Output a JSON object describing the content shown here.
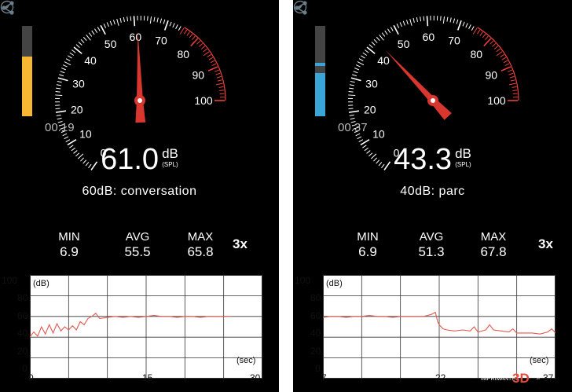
{
  "panels": [
    {
      "timer": "00:19",
      "reading_value": "61.0",
      "reading_unit": "dB",
      "reading_sub": "(SPL)",
      "description": "60dB: conversation",
      "stats": {
        "min_label": "MIN",
        "min": "6.9",
        "avg_label": "AVG",
        "avg": "55.5",
        "max_label": "MAX",
        "max": "65.8"
      },
      "multiplier": "3x",
      "level_color": "#f7b733",
      "level_fraction": 0.66,
      "needle_db": 61.0,
      "icons": {
        "share": "share-icon",
        "compass": "compass-icon"
      },
      "chart": {
        "y_label": "(dB)",
        "x_label": "(sec)",
        "y_ticks": [
          "100",
          "80",
          "60",
          "40",
          "20",
          "0"
        ],
        "x_ticks": [
          "0",
          "15",
          "30"
        ],
        "x_range": [
          0,
          30
        ],
        "y_range": [
          0,
          100
        ],
        "x_ticks_values": [
          0,
          15,
          30
        ],
        "series": [
          [
            0,
            40
          ],
          [
            0.5,
            45
          ],
          [
            1,
            41
          ],
          [
            1.5,
            50
          ],
          [
            2,
            43
          ],
          [
            2.5,
            52
          ],
          [
            3,
            44
          ],
          [
            3.5,
            53
          ],
          [
            4,
            46
          ],
          [
            4.5,
            50
          ],
          [
            5,
            47
          ],
          [
            5.5,
            51
          ],
          [
            6,
            47
          ],
          [
            6.5,
            55
          ],
          [
            7,
            52
          ],
          [
            7.5,
            58
          ],
          [
            8,
            60
          ],
          [
            8.5,
            63
          ],
          [
            9,
            58
          ],
          [
            10,
            59
          ],
          [
            11,
            60
          ],
          [
            12,
            59
          ],
          [
            13,
            60
          ],
          [
            14,
            59
          ],
          [
            15,
            60
          ],
          [
            16,
            61
          ],
          [
            17,
            60
          ],
          [
            18,
            60
          ],
          [
            19,
            59
          ],
          [
            20,
            60
          ],
          [
            21,
            60
          ],
          [
            22,
            59
          ],
          [
            23,
            60
          ],
          [
            24,
            60
          ],
          [
            25,
            60
          ],
          [
            26,
            60
          ]
        ]
      },
      "gauge": {
        "labels": [
          "0",
          "10",
          "20",
          "30",
          "40",
          "50",
          "60",
          "70",
          "80",
          "90",
          "100"
        ]
      }
    },
    {
      "timer": "00:37",
      "reading_value": "43.3",
      "reading_unit": "dB",
      "reading_sub": "(SPL)",
      "description": "40dB: parc",
      "stats": {
        "min_label": "MIN",
        "min": "6.9",
        "avg_label": "AVG",
        "avg": "51.3",
        "max_label": "MAX",
        "max": "67.8"
      },
      "multiplier": "3x",
      "level_color": "#3aa6d8",
      "level_fraction": 0.48,
      "level_marker": 0.46,
      "needle_db": 43.3,
      "icons": {
        "share": "share-icon",
        "compass": "compass-icon"
      },
      "chart": {
        "y_label": "(dB)",
        "x_label": "(sec)",
        "y_ticks": [
          "100",
          "80",
          "60",
          "40",
          "20",
          "0"
        ],
        "x_ticks": [
          "7",
          "22",
          "37"
        ],
        "x_range": [
          7,
          37
        ],
        "y_range": [
          0,
          100
        ],
        "x_ticks_values": [
          7,
          22,
          37
        ],
        "series": [
          [
            7,
            59
          ],
          [
            8,
            60
          ],
          [
            9,
            60
          ],
          [
            10,
            59
          ],
          [
            11,
            60
          ],
          [
            12,
            60
          ],
          [
            13,
            61
          ],
          [
            14,
            60
          ],
          [
            15,
            60
          ],
          [
            16,
            59
          ],
          [
            17,
            60
          ],
          [
            18,
            60
          ],
          [
            19,
            60
          ],
          [
            20,
            60
          ],
          [
            20.5,
            61
          ],
          [
            21,
            62
          ],
          [
            21.5,
            64
          ],
          [
            21.8,
            55
          ],
          [
            22,
            52
          ],
          [
            22.5,
            48
          ],
          [
            23,
            47
          ],
          [
            24,
            46
          ],
          [
            25,
            47
          ],
          [
            26,
            46
          ],
          [
            26.5,
            50
          ],
          [
            27,
            45
          ],
          [
            28,
            47
          ],
          [
            28.5,
            52
          ],
          [
            29,
            47
          ],
          [
            30,
            46
          ],
          [
            31,
            45
          ],
          [
            31.5,
            48
          ],
          [
            32,
            44
          ],
          [
            33,
            44
          ],
          [
            34,
            44
          ],
          [
            35,
            43
          ],
          [
            36,
            45
          ],
          [
            36.5,
            48
          ],
          [
            37,
            44
          ]
        ]
      },
      "gauge": {
        "labels": [
          "0",
          "10",
          "20",
          "30",
          "40",
          "50",
          "60",
          "70",
          "80",
          "90",
          "100"
        ]
      }
    }
  ],
  "watermark": {
    "line1": "LES",
    "line2": "IMPRIMANTES",
    "big": "3D",
    "tld": ".fr"
  }
}
